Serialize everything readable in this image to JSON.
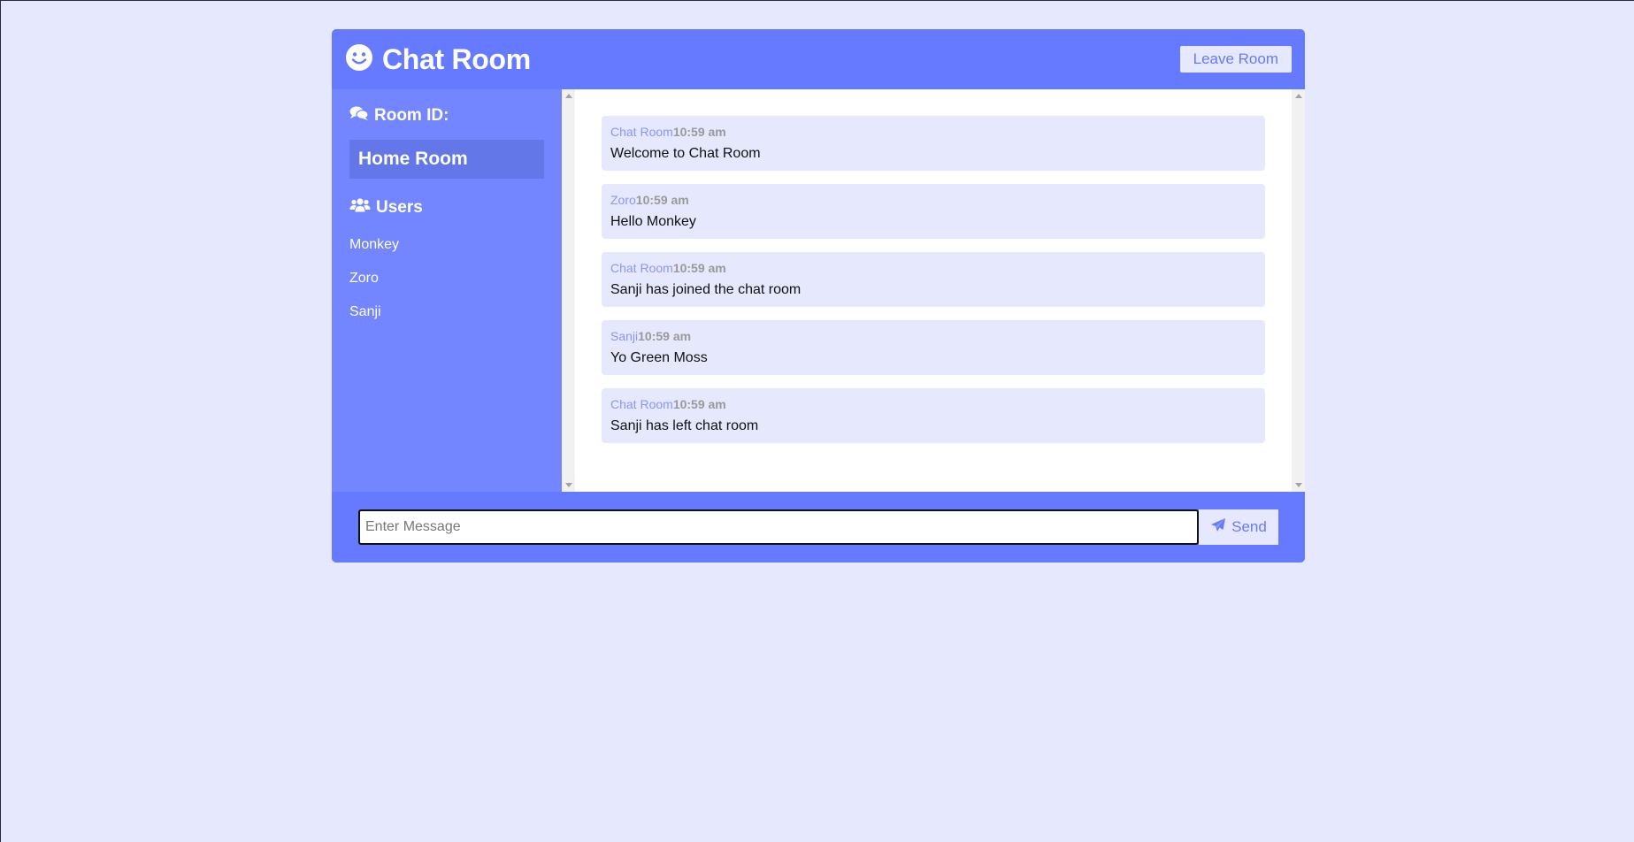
{
  "header": {
    "title": "Chat Room",
    "leave_label": "Leave Room"
  },
  "sidebar": {
    "room_heading": "Room ID:",
    "room_name": "Home Room",
    "users_heading": "Users",
    "users": [
      "Monkey",
      "Zoro",
      "Sanji"
    ]
  },
  "messages": [
    {
      "author": "Chat Room",
      "time": "10:59 am",
      "text": "Welcome to Chat Room"
    },
    {
      "author": "Zoro",
      "time": "10:59 am",
      "text": "Hello Monkey"
    },
    {
      "author": "Chat Room",
      "time": "10:59 am",
      "text": "Sanji has joined the chat room"
    },
    {
      "author": "Sanji",
      "time": "10:59 am",
      "text": "Yo Green Moss"
    },
    {
      "author": "Chat Room",
      "time": "10:59 am",
      "text": "Sanji has left chat room"
    }
  ],
  "composer": {
    "placeholder": "Enter Message",
    "value": "",
    "send_label": "Send"
  },
  "icons": {
    "brand": "smile-icon",
    "room": "comments-icon",
    "users": "users-icon",
    "send": "paper-plane-icon"
  },
  "colors": {
    "primary": "#667aff",
    "sidebar": "#7386ff",
    "light": "#e6e9fd",
    "room_highlight": "#6477e8"
  }
}
